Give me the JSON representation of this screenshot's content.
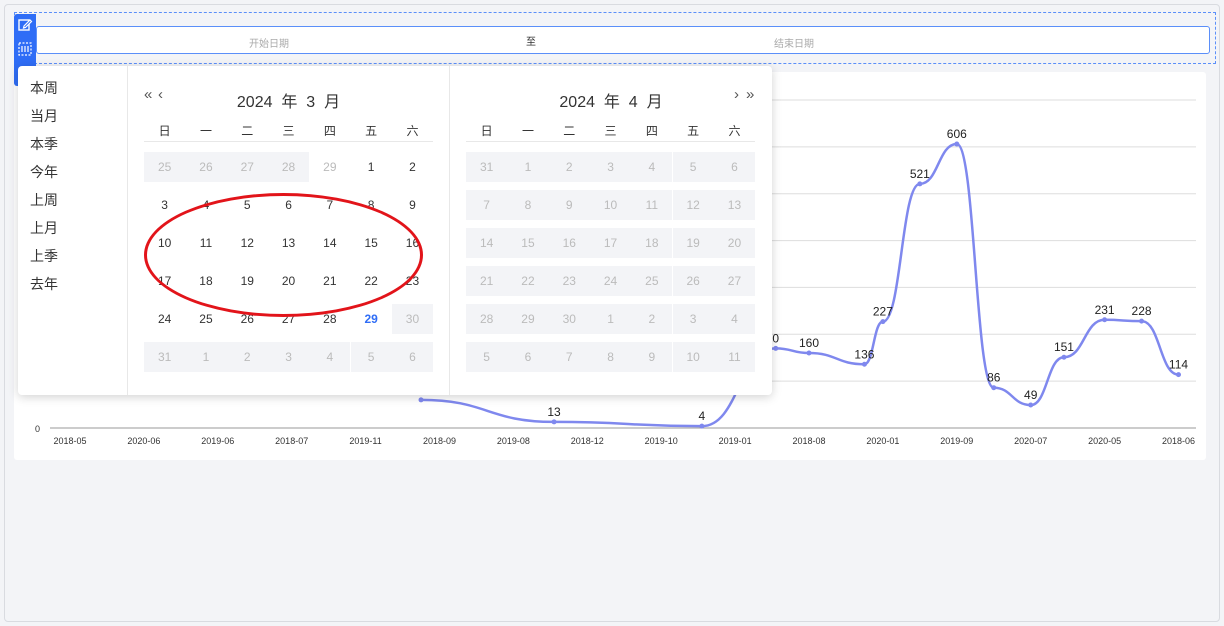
{
  "range": {
    "start_placeholder": "开始日期",
    "separator": "至",
    "end_placeholder": "结束日期"
  },
  "toolbar": {
    "edit_icon": "edit-icon",
    "grid_icon": "grid-icon"
  },
  "shortcuts": [
    "本周",
    "当月",
    "本季",
    "今年",
    "上周",
    "上月",
    "上季",
    "去年"
  ],
  "calendar_left": {
    "year": "2024",
    "year_unit": "年",
    "month": "3",
    "month_unit": "月",
    "prev_year": "«",
    "prev_month": "‹",
    "weekdays": [
      "日",
      "一",
      "二",
      "三",
      "四",
      "五",
      "六"
    ],
    "days": [
      {
        "d": "25",
        "t": "muted"
      },
      {
        "d": "26",
        "t": "muted"
      },
      {
        "d": "27",
        "t": "muted"
      },
      {
        "d": "28",
        "t": "muted"
      },
      {
        "d": "29",
        "t": "ghost"
      },
      {
        "d": "1",
        "t": ""
      },
      {
        "d": "2",
        "t": ""
      },
      {
        "d": "3",
        "t": ""
      },
      {
        "d": "4",
        "t": ""
      },
      {
        "d": "5",
        "t": ""
      },
      {
        "d": "6",
        "t": ""
      },
      {
        "d": "7",
        "t": ""
      },
      {
        "d": "8",
        "t": ""
      },
      {
        "d": "9",
        "t": ""
      },
      {
        "d": "10",
        "t": ""
      },
      {
        "d": "11",
        "t": ""
      },
      {
        "d": "12",
        "t": ""
      },
      {
        "d": "13",
        "t": ""
      },
      {
        "d": "14",
        "t": ""
      },
      {
        "d": "15",
        "t": ""
      },
      {
        "d": "16",
        "t": ""
      },
      {
        "d": "17",
        "t": ""
      },
      {
        "d": "18",
        "t": ""
      },
      {
        "d": "19",
        "t": ""
      },
      {
        "d": "20",
        "t": ""
      },
      {
        "d": "21",
        "t": ""
      },
      {
        "d": "22",
        "t": ""
      },
      {
        "d": "23",
        "t": ""
      },
      {
        "d": "24",
        "t": ""
      },
      {
        "d": "25",
        "t": ""
      },
      {
        "d": "26",
        "t": ""
      },
      {
        "d": "27",
        "t": ""
      },
      {
        "d": "28",
        "t": ""
      },
      {
        "d": "29",
        "t": "today"
      },
      {
        "d": "30",
        "t": "muted"
      },
      {
        "d": "31",
        "t": "muted"
      },
      {
        "d": "1",
        "t": "muted"
      },
      {
        "d": "2",
        "t": "muted"
      },
      {
        "d": "3",
        "t": "muted"
      },
      {
        "d": "4",
        "t": "muted"
      },
      {
        "d": "5",
        "t": "muted"
      },
      {
        "d": "6",
        "t": "muted"
      }
    ]
  },
  "calendar_right": {
    "year": "2024",
    "year_unit": "年",
    "month": "4",
    "month_unit": "月",
    "next_month": "›",
    "next_year": "»",
    "weekdays": [
      "日",
      "一",
      "二",
      "三",
      "四",
      "五",
      "六"
    ],
    "days": [
      {
        "d": "31",
        "t": "muted"
      },
      {
        "d": "1",
        "t": "muted"
      },
      {
        "d": "2",
        "t": "muted"
      },
      {
        "d": "3",
        "t": "muted"
      },
      {
        "d": "4",
        "t": "muted"
      },
      {
        "d": "5",
        "t": "muted"
      },
      {
        "d": "6",
        "t": "muted"
      },
      {
        "d": "7",
        "t": "muted"
      },
      {
        "d": "8",
        "t": "muted"
      },
      {
        "d": "9",
        "t": "muted"
      },
      {
        "d": "10",
        "t": "muted"
      },
      {
        "d": "11",
        "t": "muted"
      },
      {
        "d": "12",
        "t": "muted"
      },
      {
        "d": "13",
        "t": "muted"
      },
      {
        "d": "14",
        "t": "muted"
      },
      {
        "d": "15",
        "t": "muted"
      },
      {
        "d": "16",
        "t": "muted"
      },
      {
        "d": "17",
        "t": "muted"
      },
      {
        "d": "18",
        "t": "muted"
      },
      {
        "d": "19",
        "t": "muted"
      },
      {
        "d": "20",
        "t": "muted"
      },
      {
        "d": "21",
        "t": "muted"
      },
      {
        "d": "22",
        "t": "muted"
      },
      {
        "d": "23",
        "t": "muted"
      },
      {
        "d": "24",
        "t": "muted"
      },
      {
        "d": "25",
        "t": "muted"
      },
      {
        "d": "26",
        "t": "muted"
      },
      {
        "d": "27",
        "t": "muted"
      },
      {
        "d": "28",
        "t": "muted"
      },
      {
        "d": "29",
        "t": "muted"
      },
      {
        "d": "30",
        "t": "muted"
      },
      {
        "d": "1",
        "t": "muted"
      },
      {
        "d": "2",
        "t": "muted"
      },
      {
        "d": "3",
        "t": "muted"
      },
      {
        "d": "4",
        "t": "muted"
      },
      {
        "d": "5",
        "t": "muted"
      },
      {
        "d": "6",
        "t": "muted"
      },
      {
        "d": "7",
        "t": "muted"
      },
      {
        "d": "8",
        "t": "muted"
      },
      {
        "d": "9",
        "t": "muted"
      },
      {
        "d": "10",
        "t": "muted"
      },
      {
        "d": "11",
        "t": "muted"
      }
    ]
  },
  "colors": {
    "accent": "#2f6df6",
    "line": "#7f88ee",
    "annotation": "#e2141a"
  },
  "chart_data": {
    "type": "line",
    "categories": [
      "2018-05",
      "2020-06",
      "2019-06",
      "2018-07",
      "2019-11",
      "2018-09",
      "2019-08",
      "2018-12",
      "2019-10",
      "2019-01",
      "2018-08",
      "2020-01",
      "2019-09",
      "2020-07",
      "2020-05",
      "2018-06"
    ],
    "points": [
      {
        "x": "2018-05",
        "y": null,
        "label": ""
      },
      {
        "x": "2020-06",
        "y": null,
        "label": ""
      },
      {
        "x": "2019-06",
        "y": null,
        "label": ""
      },
      {
        "x": "2018-07",
        "y": null,
        "label": ""
      },
      {
        "x": "2019-11",
        "y": null,
        "label": ""
      },
      {
        "x": "2018-09",
        "y": null,
        "label": ""
      },
      {
        "x": "2019-08",
        "y": 13,
        "label": "13"
      },
      {
        "x": "2018-12",
        "y": null,
        "label": ""
      },
      {
        "x": "2019-10",
        "y": 4,
        "label": "4"
      },
      {
        "x": "2019-01",
        "y": null,
        "label": "0"
      },
      {
        "x": "2018-08",
        "y": 160,
        "label": "160"
      },
      {
        "x": "2020-01",
        "y": 136,
        "label": "136"
      },
      {
        "x": "2019-09",
        "y": 227,
        "label": "227"
      },
      {
        "x": "2020-07",
        "y": 521,
        "label": "521"
      },
      {
        "x": "2020-05",
        "y": 606,
        "label": "606"
      },
      {
        "x": "2018-06",
        "y": 86,
        "label": "86"
      }
    ],
    "visible_series": [
      {
        "x": "2019-11",
        "y": 60
      },
      {
        "x": "2019-08",
        "y": 13
      },
      {
        "x": "2019-10",
        "y": 4
      },
      {
        "x": "2019-01",
        "y": 170
      },
      {
        "x": "2018-08",
        "y": 160
      },
      {
        "x": "2020-01",
        "y": 136
      },
      {
        "x": "2019-09",
        "y": 227
      },
      {
        "x": "2020-07",
        "y": 521
      },
      {
        "x": "2020-05",
        "y": 606
      },
      {
        "x": "2018-06",
        "y": 86
      },
      {
        "x": "2020-07b",
        "y": 49
      },
      {
        "x": "2020-05b",
        "y": 151
      },
      {
        "x": "2018-06b",
        "y": 231
      },
      {
        "x": "2018-06c",
        "y": 228
      },
      {
        "x": "2018-06d",
        "y": 114
      }
    ],
    "labels": [
      "0",
      "160",
      "136",
      "227",
      "521",
      "606",
      "86",
      "49",
      "151",
      "231",
      "228",
      "114",
      "13",
      "4"
    ],
    "ylim": [
      0,
      700
    ],
    "y_tick_label": "0",
    "grid": true
  }
}
